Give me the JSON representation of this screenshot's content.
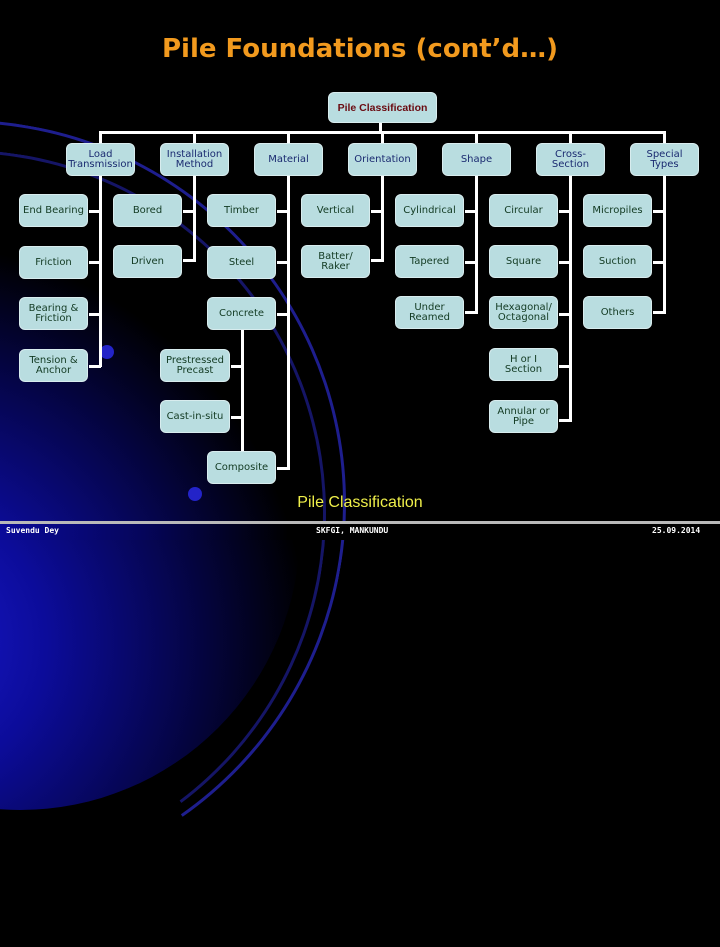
{
  "slide": {
    "title": "Pile Foundations (cont’d…)",
    "caption": "Pile Classification",
    "footer": {
      "author": "Suvendu Dey",
      "institution": "SKFGI, MANKUNDU",
      "date": "25.09.2014"
    }
  },
  "diagram": {
    "root": "Pile Classification",
    "categories": [
      {
        "label": "Load Transmission",
        "children": [
          "End Bearing",
          "Friction",
          "Bearing & Friction",
          "Tension & Anchor"
        ]
      },
      {
        "label": "Installation Method",
        "children": [
          "Bored",
          "Driven"
        ]
      },
      {
        "label": "Material",
        "children": [
          "Timber",
          "Steel",
          "Concrete",
          "Composite"
        ],
        "sub": {
          "Concrete": [
            "Prestressed Precast",
            "Cast-in-situ"
          ]
        }
      },
      {
        "label": "Orientation",
        "children": [
          "Vertical",
          "Batter/ Raker"
        ]
      },
      {
        "label": "Shape",
        "children": [
          "Cylindrical",
          "Tapered",
          "Under Reamed"
        ]
      },
      {
        "label": "Cross-Section",
        "children": [
          "Circular",
          "Square",
          "Hexagonal/ Octagonal",
          "H or I Section",
          "Annular or Pipe"
        ]
      },
      {
        "label": "Special Types",
        "children": [
          "Micropiles",
          "Suction",
          "Others"
        ]
      }
    ]
  },
  "colors": {
    "title": "#f29a1e",
    "node_fill": "#b9dde0",
    "caption": "#f0f04a",
    "root_text": "#6a0a10"
  }
}
